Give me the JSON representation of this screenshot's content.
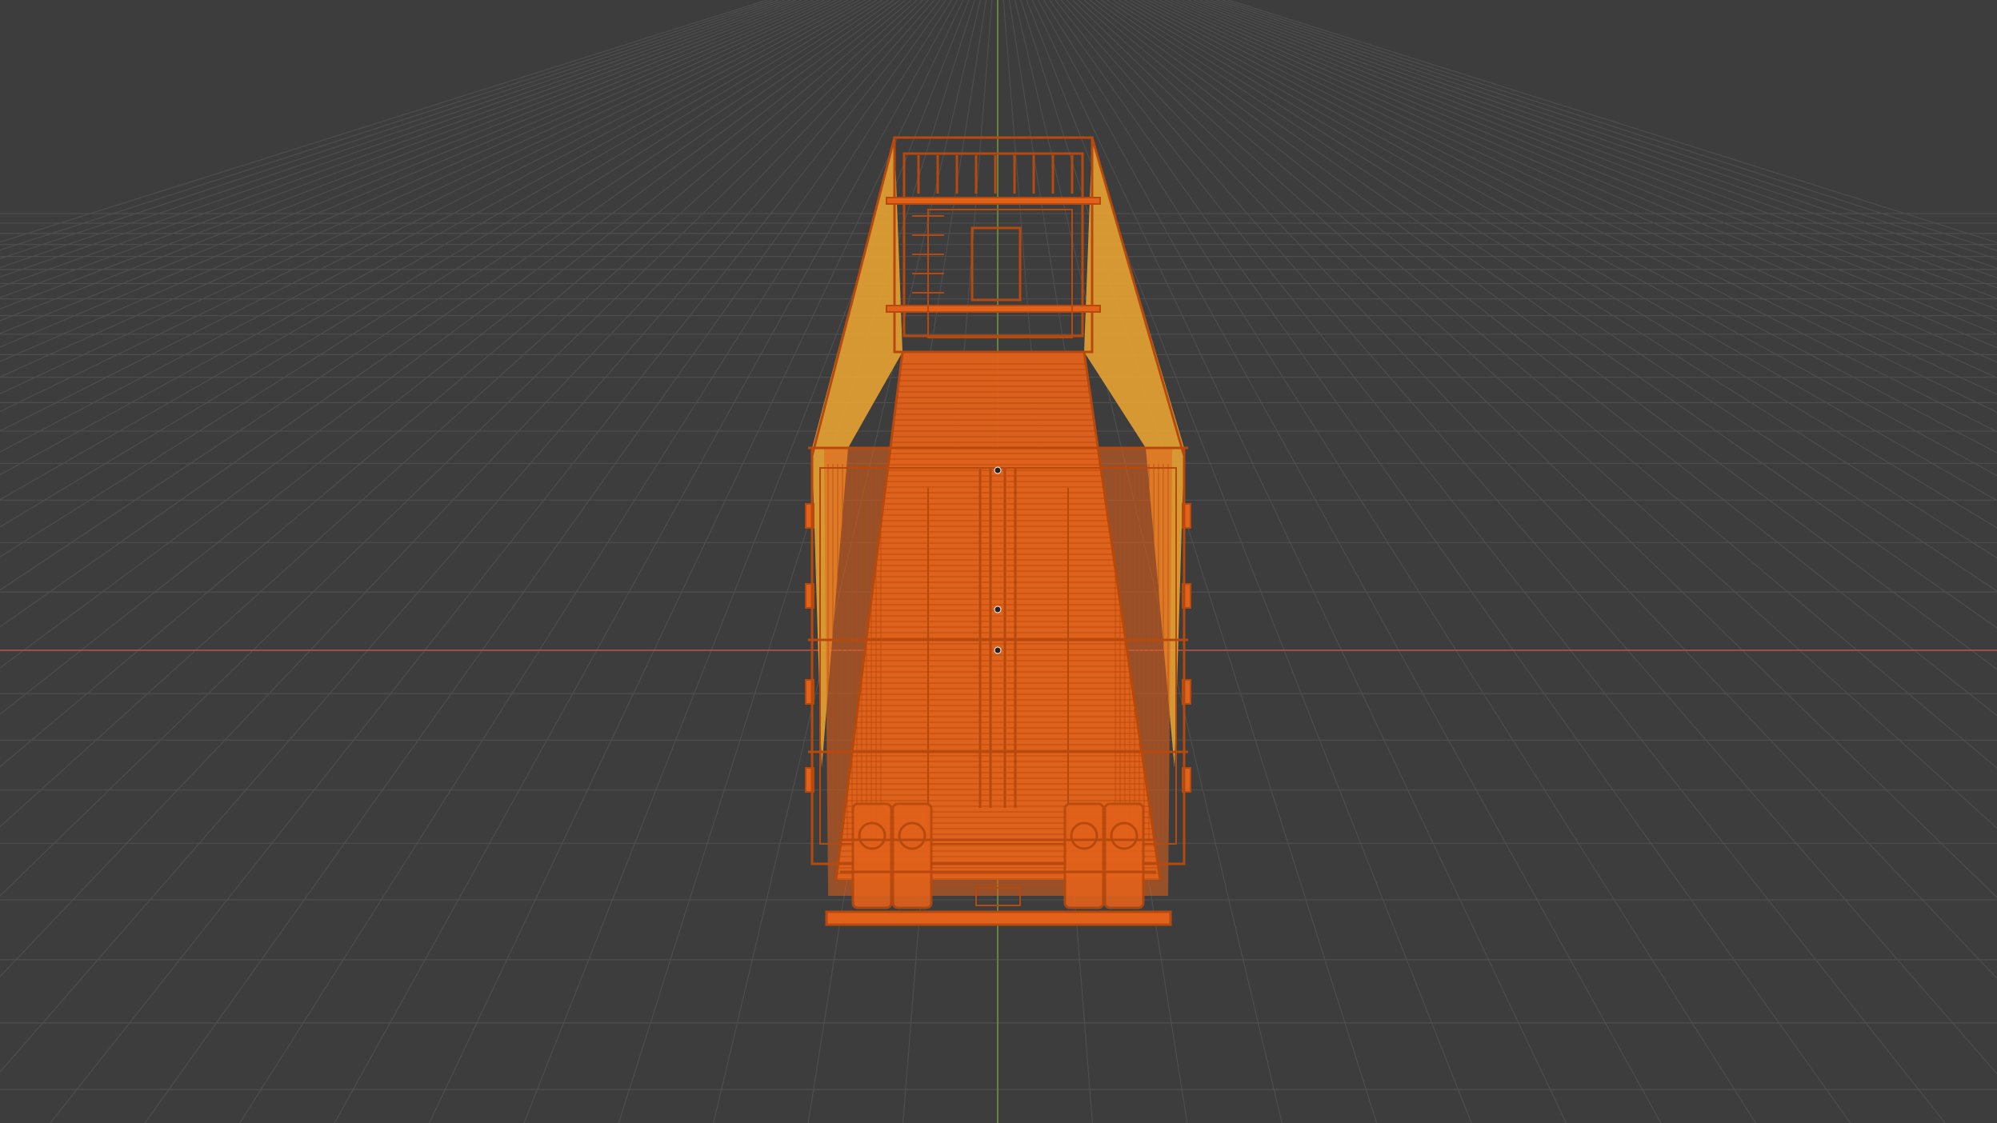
{
  "viewport": {
    "mode": "3D viewport",
    "shading": "wireframe",
    "background_color": "#3d3d3d",
    "grid_color": "#4e4e4e",
    "x_axis_color": "#b85454",
    "y_axis_color": "#6f9a3b"
  },
  "selected_object": {
    "type": "trailer",
    "wire_color": "#e2621b",
    "wire_color_dark": "#b8490d",
    "face_color": "#f0a830"
  }
}
